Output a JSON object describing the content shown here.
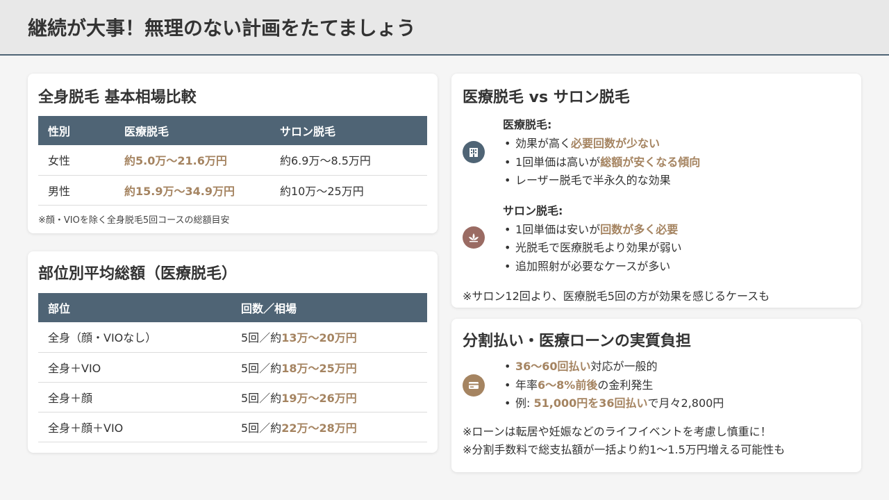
{
  "header": {
    "title": "継続が大事！無理のない計画をたてましょう"
  },
  "basic": {
    "title": "全身脱毛 基本相場比較",
    "columns": [
      "性別",
      "医療脱毛",
      "サロン脱毛"
    ],
    "rows": [
      {
        "gender": "女性",
        "medical": "約5.0万〜21.6万円",
        "salon": "約6.9万〜8.5万円"
      },
      {
        "gender": "男性",
        "medical": "約15.9万〜34.9万円",
        "salon": "約10万〜25万円"
      }
    ],
    "note": "※顔・VIOを除く全身脱毛5回コースの総額目安"
  },
  "parts": {
    "title": "部位別平均総額（医療脱毛）",
    "columns": [
      "部位",
      "回数／相場"
    ],
    "rows": [
      {
        "part": "全身（顔・VIOなし）",
        "prefix": "5回／約",
        "price": "13万〜20万円"
      },
      {
        "part": "全身＋VIO",
        "prefix": "5回／約",
        "price": "18万〜25万円"
      },
      {
        "part": "全身＋顔",
        "prefix": "5回／約",
        "price": "19万〜26万円"
      },
      {
        "part": "全身＋顔＋VIO",
        "prefix": "5回／約",
        "price": "22万〜28万円"
      }
    ]
  },
  "compare": {
    "title": "医療脱毛 vs サロン脱毛",
    "medical": {
      "title": "医療脱毛:",
      "icon": "hospital-icon",
      "b1_pre": "効果が高く",
      "b1_hl": "必要回数が少ない",
      "b2_pre": "1回単価は高いが",
      "b2_hl": "総額が安くなる傾向",
      "b3": "レーザー脱毛で半永久的な効果"
    },
    "salon": {
      "title": "サロン脱毛:",
      "icon": "spa-icon",
      "b1_pre": "1回単価は安いが",
      "b1_hl": "回数が多く必要",
      "b2": "光脱毛で医療脱毛より効果が弱い",
      "b3": "追加照射が必要なケースが多い"
    },
    "note": "※サロン12回より、医療脱毛5回の方が効果を感じるケースも"
  },
  "loan": {
    "title": "分割払い・医療ローンの実質負担",
    "icon": "credit-card-icon",
    "b1_hl": "36〜60回払い",
    "b1_post": "対応が一般的",
    "b2_pre": "年率",
    "b2_hl": "6〜8%前後",
    "b2_post": "の金利発生",
    "b3_pre": "例: ",
    "b3_hl": "51,000円を36回払い",
    "b3_post": "で月々2,800円",
    "note1": "※ローンは転居や妊娠などのライフイベントを考慮し慎重に！",
    "note2": "※分割手数料で総支払額が一括より約1〜1.5万円増える可能性も"
  },
  "colors": {
    "accent": "#a58461",
    "table_header": "#4f6475",
    "icon_medical": "#4f6475",
    "icon_salon": "#9a6b63",
    "icon_loan": "#a58461"
  }
}
